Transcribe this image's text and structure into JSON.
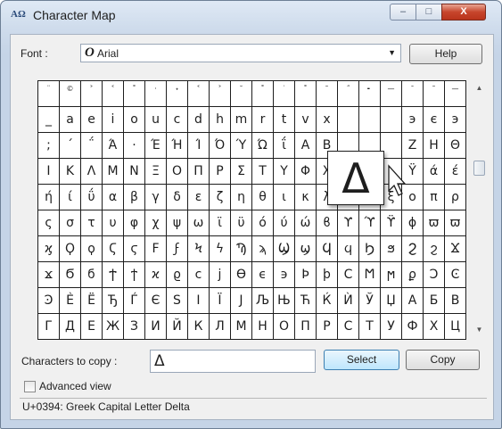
{
  "window": {
    "title": "Character Map",
    "app_icon": "charmap-icon",
    "minimize_label": "–",
    "maximize_label": "□",
    "close_label": "X"
  },
  "font": {
    "label": "Font :",
    "type_glyph": "O",
    "selected": "Arial",
    "dropdown_arrow": "▼"
  },
  "help_button": "Help",
  "grid": {
    "rows": [
      [
        "¨",
        "©",
        "˃",
        "˂",
        "˚",
        "·",
        "˖",
        "˂",
        "˃",
        "˘",
        "˚",
        "˙",
        "˚",
        "˜",
        "˝",
        "╸",
        "—",
        "¯",
        "˜",
        "—"
      ],
      [
        "_",
        "a",
        "e",
        "i",
        "o",
        "u",
        "c",
        "d",
        "h",
        "m",
        "r",
        "t",
        "v",
        "x",
        "",
        "",
        "",
        "э",
        "є",
        "э"
      ],
      [
        ";",
        "΄",
        "΅",
        "Ά",
        "·",
        "Έ",
        "Ή",
        "Ί",
        "Ό",
        "Ύ",
        "Ώ",
        "ΐ",
        "Α",
        "Β",
        "",
        "",
        "",
        "Ζ",
        "Η",
        "Θ"
      ],
      [
        "Ι",
        "Κ",
        "Λ",
        "Μ",
        "Ν",
        "Ξ",
        "Ο",
        "Π",
        "Ρ",
        "Σ",
        "Τ",
        "Υ",
        "Φ",
        "Χ",
        "",
        "",
        "",
        "Ϋ",
        "ά",
        "έ"
      ],
      [
        "ή",
        "ί",
        "ΰ",
        "α",
        "β",
        "γ",
        "δ",
        "ε",
        "ζ",
        "η",
        "θ",
        "ι",
        "κ",
        "λ",
        "μ",
        "ν",
        "ξ",
        "ο",
        "π",
        "ρ"
      ],
      [
        "ς",
        "σ",
        "τ",
        "υ",
        "φ",
        "χ",
        "ψ",
        "ω",
        "ϊ",
        "ϋ",
        "ό",
        "ύ",
        "ώ",
        "ϐ",
        "ϒ",
        "ϓ",
        "ϔ",
        "ϕ",
        "ϖ",
        "ϖ"
      ],
      [
        "ϗ",
        "Ϙ",
        "ϙ",
        "Ϛ",
        "ϛ",
        "Ϝ",
        "ϝ",
        "Ϟ",
        "ϟ",
        "Ϡ",
        "ϡ",
        "Ϣ",
        "ϣ",
        "Ϥ",
        "ϥ",
        "Ϧ",
        "ϧ",
        "Ϩ",
        "ϩ",
        "Ϫ"
      ],
      [
        "ϫ",
        "Ϭ",
        "ϭ",
        "Ϯ",
        "ϯ",
        "ϰ",
        "ϱ",
        "ϲ",
        "ϳ",
        "ϴ",
        "ϵ",
        "϶",
        "Ϸ",
        "ϸ",
        "Ϲ",
        "Ϻ",
        "ϻ",
        "ϼ",
        "Ͻ",
        "Ͼ"
      ],
      [
        "Ͽ",
        "Ѐ",
        "Ё",
        "Ђ",
        "Ѓ",
        "Є",
        "Ѕ",
        "І",
        "Ї",
        "Ј",
        "Љ",
        "Њ",
        "Ћ",
        "Ќ",
        "Ѝ",
        "Ў",
        "Џ",
        "А",
        "Б",
        "В"
      ],
      [
        "Г",
        "Д",
        "Е",
        "Ж",
        "З",
        "И",
        "Й",
        "К",
        "Л",
        "М",
        "Н",
        "О",
        "П",
        "Р",
        "С",
        "Т",
        "У",
        "Ф",
        "Х",
        "Ц"
      ]
    ]
  },
  "zoom_char": "Δ",
  "scroll_up_arrow": "▲",
  "scroll_down_arrow": "▼",
  "copy_label": "Characters to copy :",
  "copy_value": "Δ",
  "select_button": "Select",
  "copy_button": "Copy",
  "advanced_label": "Advanced view",
  "status_text": "U+0394: Greek Capital Letter Delta"
}
